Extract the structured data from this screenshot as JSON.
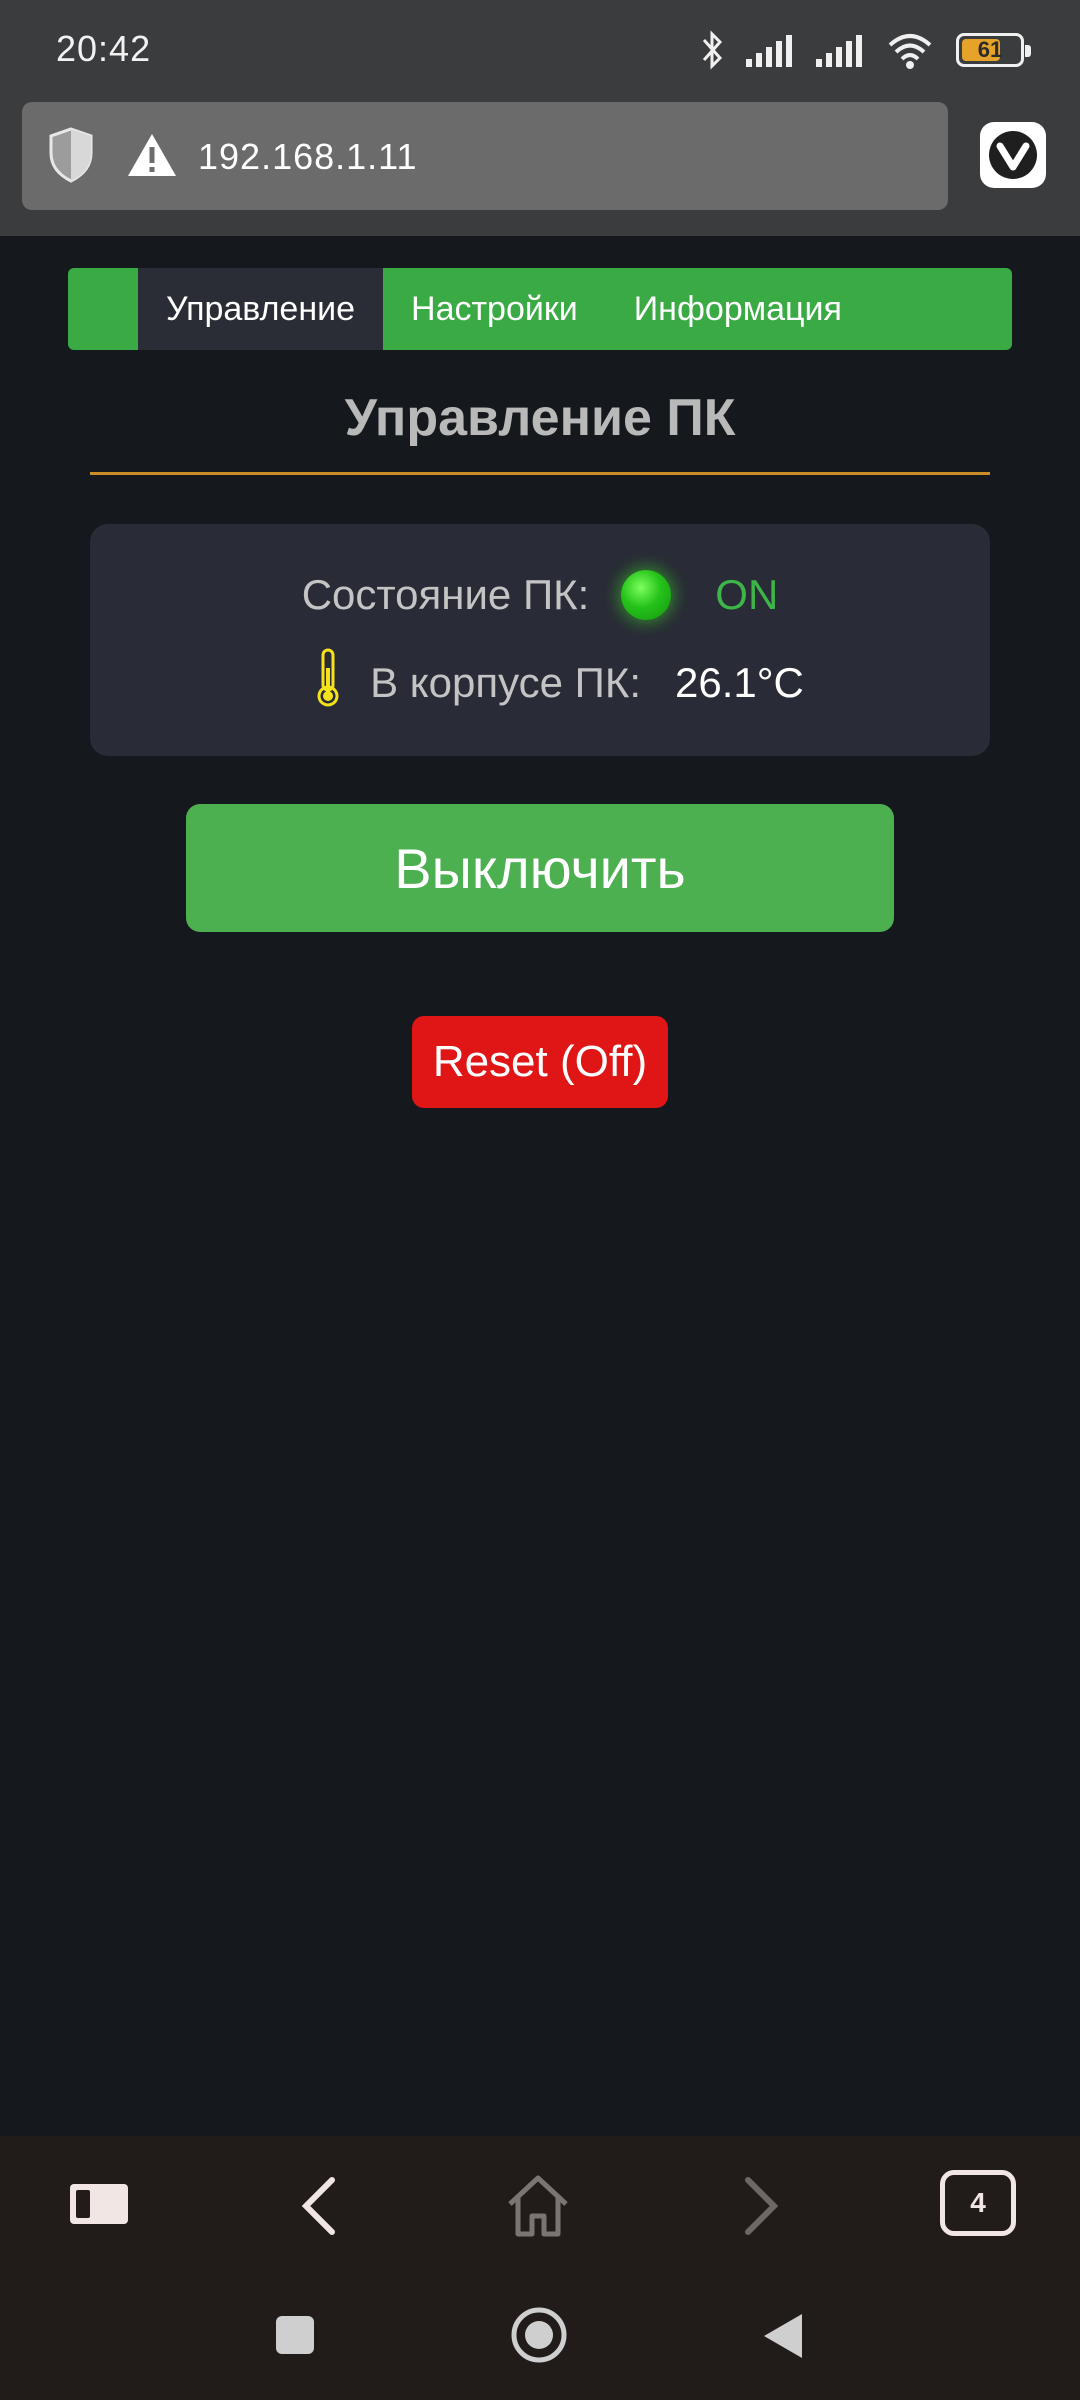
{
  "status_bar": {
    "time": "20:42",
    "battery_level": "61",
    "icons": [
      "bluetooth-icon",
      "signal-icon",
      "signal-icon",
      "wifi-icon",
      "battery-icon"
    ]
  },
  "browser": {
    "url": "192.168.1.11",
    "security_icon": "warning-icon",
    "shield_icon": "shield-icon",
    "menu_icon": "vivaldi-logo-icon"
  },
  "nav": {
    "tabs": [
      {
        "label": "Управление",
        "active": true
      },
      {
        "label": "Настройки",
        "active": false
      },
      {
        "label": "Информация",
        "active": false
      }
    ]
  },
  "main": {
    "title": "Управление ПК",
    "state_label": "Состояние ПК:",
    "state_value": "ON",
    "temp_label": "В корпусе ПК:",
    "temp_value": "26.1°C",
    "power_button": "Выключить",
    "reset_button": "Reset (Off)"
  },
  "colors": {
    "nav_green": "#3aaa44",
    "power_button": "#4caf50",
    "reset_button": "#e01515",
    "state_on": "#3db548",
    "title_line": "#c98e25"
  },
  "toolbar": {
    "tab_count": "4",
    "icons": [
      "panel-icon",
      "back-icon",
      "home-icon",
      "forward-icon",
      "tabs-icon"
    ]
  },
  "system_nav": {
    "icons": [
      "recents-icon",
      "home-circle-icon",
      "back-triangle-icon"
    ]
  }
}
